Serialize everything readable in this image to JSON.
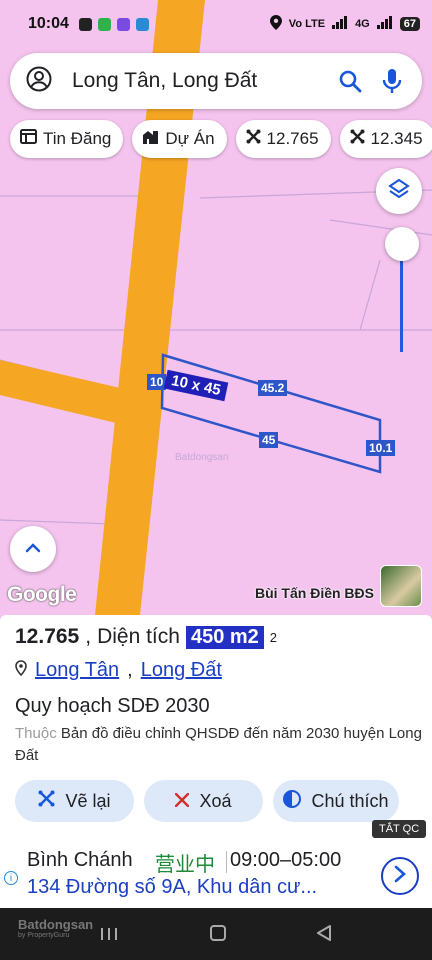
{
  "status": {
    "time": "10:04",
    "network": "Vo LTE",
    "network_2": "4G",
    "battery": "67"
  },
  "search": {
    "query": "Long Tân, Long Đất"
  },
  "chips": [
    {
      "label": "Tin Đăng",
      "icon": "listing-icon"
    },
    {
      "label": "Dự Án",
      "icon": "building-icon"
    },
    {
      "label": "12.765",
      "icon": "parcel-icon"
    },
    {
      "label": "12.345",
      "icon": "parcel-icon"
    }
  ],
  "map": {
    "google_label": "Google",
    "owner_label": "Bùi Tấn Điền BĐS",
    "plot": {
      "side_left": "10",
      "side_top": "45.2",
      "side_bottom": "45",
      "side_right": "10.1",
      "dimensions": "10 x 45"
    },
    "road_color": "#f5a623",
    "land_color": "#f4c4ee"
  },
  "panel": {
    "parcel_no": "12.765",
    "area_label": "Diện tích",
    "area_value": "450 m2",
    "area_superscript": "2",
    "ward": "Long Tân",
    "district": "Long Đất",
    "plan_title": "Quy hoạch SDĐ 2030",
    "desc_prefix": "Thuộc",
    "desc_text": "Bản đồ điều chỉnh QHSDĐ đến năm 2030 huyện Long Đất",
    "actions": [
      {
        "label": "Vẽ lại",
        "icon": "redraw-icon"
      },
      {
        "label": "Xoá",
        "icon": "close-icon"
      },
      {
        "label": "Chú thích",
        "icon": "legend-icon"
      }
    ]
  },
  "ad": {
    "close_label": "TẮT QC",
    "name": "Bình Chánh",
    "open_status": "营业中",
    "hours": "09:00–05:00",
    "address": "134 Đường số 9A, Khu dân cư..."
  },
  "nav": {
    "watermark": "Batdongsan",
    "watermark_sub": "by PropertyGuru"
  }
}
